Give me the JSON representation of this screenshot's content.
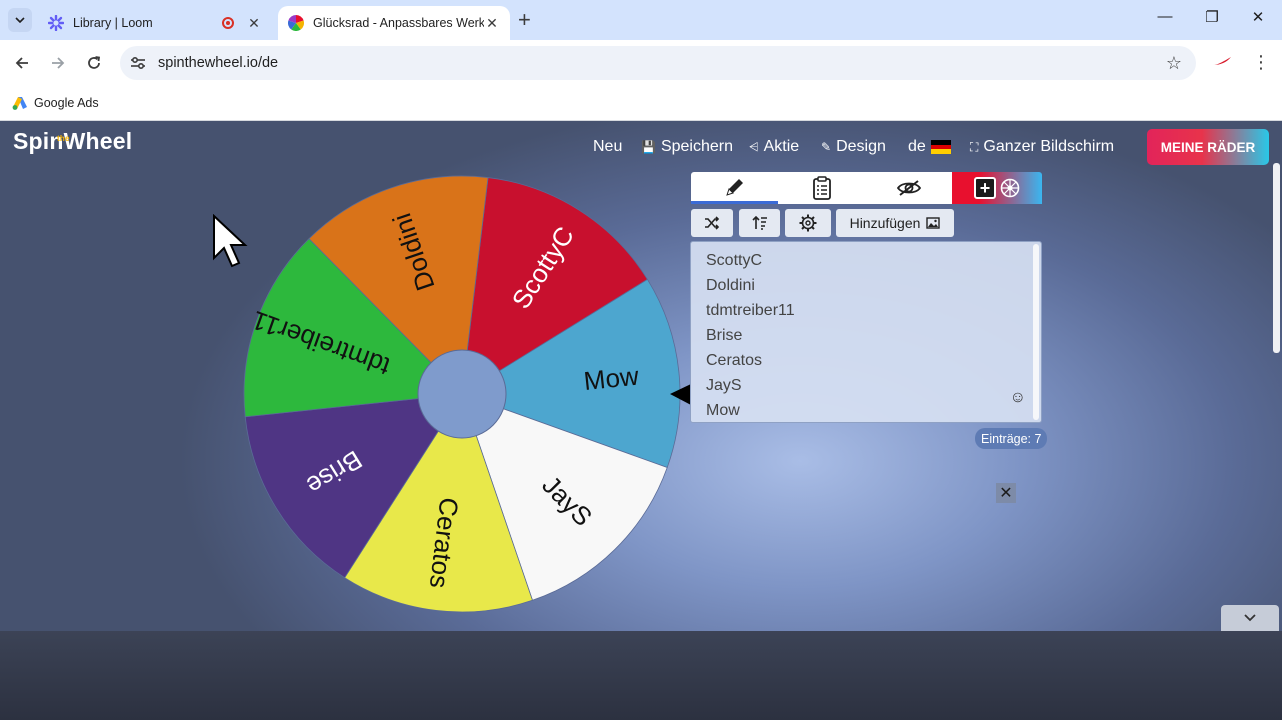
{
  "browser": {
    "tabs": [
      {
        "title": "Library | Loom",
        "active": false,
        "recording": true
      },
      {
        "title": "Glücksrad - Anpassbares Werkzeug",
        "active": true
      }
    ],
    "url": "spinthewheel.io/de",
    "bookmarks": [
      {
        "label": "Google Ads"
      }
    ]
  },
  "site": {
    "logo_main": "Spin",
    "logo_small": "the",
    "logo_end": "Wheel",
    "nav": {
      "neu": "Neu",
      "speichern": "Speichern",
      "aktie": "Aktie",
      "design": "Design",
      "lang": "de",
      "fullscreen": "Ganzer Bildschirm"
    },
    "my_wheels": "MEINE RÄDER"
  },
  "wheel": {
    "segments": [
      {
        "label": "ScottyC",
        "color": "#c8102e",
        "text_color": "#ffffff"
      },
      {
        "label": "Mow",
        "color": "#4da6cf",
        "text_color": "#111111"
      },
      {
        "label": "JayS",
        "color": "#f8f8f8",
        "text_color": "#111111"
      },
      {
        "label": "Ceratos",
        "color": "#e8e84a",
        "text_color": "#111111"
      },
      {
        "label": "Brise",
        "color": "#4f3584",
        "text_color": "#ffffff"
      },
      {
        "label": "tdmtreiber11",
        "color": "#2db83d",
        "text_color": "#111111"
      },
      {
        "label": "Doldini",
        "color": "#d97319",
        "text_color": "#111111"
      }
    ],
    "hub_color": "#7f9bcc"
  },
  "panel": {
    "add_button": "Hinzufügen",
    "entries": [
      "ScottyC",
      "Doldini",
      "tdmtreiber11",
      "Brise",
      "Ceratos",
      "JayS",
      "Mow"
    ],
    "count_label": "Einträge: 7"
  },
  "colors": {
    "accent_blue": "#3b6bd6",
    "my_wheels_gradient_start": "#e2245a",
    "my_wheels_gradient_end": "#29c8e8"
  }
}
